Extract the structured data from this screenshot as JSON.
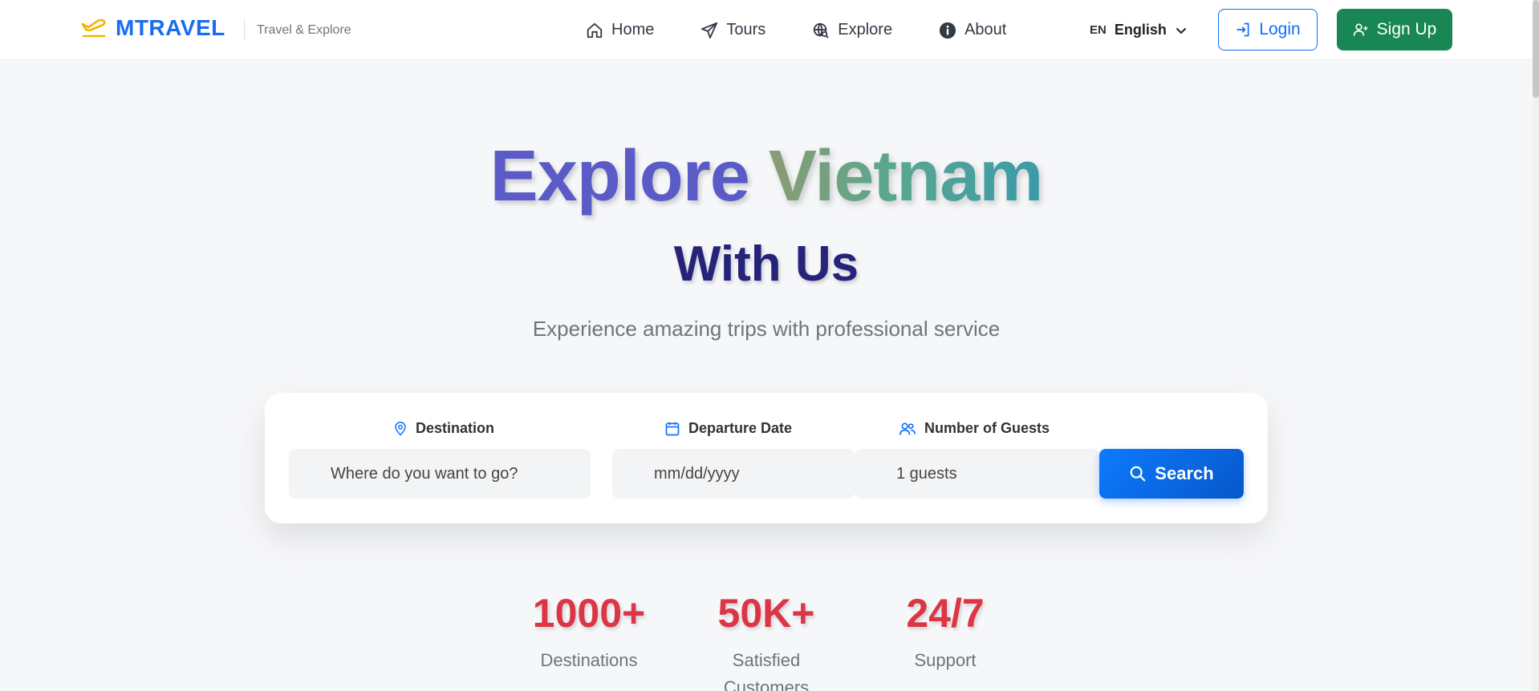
{
  "header": {
    "brand_name": "MTRAVEL",
    "tagline": "Travel & Explore",
    "nav": [
      {
        "label": "Home",
        "icon": "home-icon"
      },
      {
        "label": "Tours",
        "icon": "send-icon"
      },
      {
        "label": "Explore",
        "icon": "globe-search-icon"
      },
      {
        "label": "About",
        "icon": "info-icon"
      }
    ],
    "language": {
      "code": "EN",
      "name": "English"
    },
    "login_label": "Login",
    "signup_label": "Sign Up"
  },
  "hero": {
    "title_word1": "Explore",
    "title_word2": "Vietnam",
    "subtitle": "With Us",
    "description": "Experience amazing trips with professional service"
  },
  "search": {
    "destination_label": "Destination",
    "destination_placeholder": "Where do you want to go?",
    "date_label": "Departure Date",
    "date_placeholder": "mm/dd/yyyy",
    "guests_label": "Number of Guests",
    "guests_value": "1 guests",
    "button_label": "Search"
  },
  "stats": [
    {
      "value": "1000+",
      "label": "Destinations"
    },
    {
      "value": "50K+",
      "label": "Satisfied Customers"
    },
    {
      "value": "24/7",
      "label": "Support"
    }
  ],
  "colors": {
    "brand": "#1a6cf0",
    "primary": "#0d6efd",
    "success": "#198754",
    "danger": "#dc3545",
    "title_purple": "#5b5bc8",
    "subtitle_navy": "#25237a"
  }
}
